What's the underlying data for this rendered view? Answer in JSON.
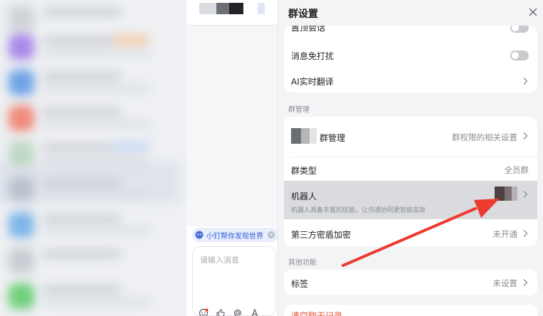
{
  "chat": {
    "hint_pill_text": "小钉帮你发现世界",
    "composer_placeholder": "请输入消息"
  },
  "panel": {
    "title": "群设置",
    "top_card": {
      "pinned_label": "置顶会话",
      "mute_label": "消息免打扰",
      "translate_label": "AI实时翻译"
    },
    "section_group_label": "群管理",
    "group_card": {
      "manage_label": "群管理",
      "manage_value": "群权限的相关设置",
      "type_label": "群类型",
      "type_value": "全员群",
      "robot_label": "机器人",
      "robot_desc": "机器人具备丰富的技能，让沟通协同更智能高效",
      "encrypt_label": "第三方密盾加密",
      "encrypt_value": "未开通"
    },
    "section_other_label": "其他功能",
    "other_card": {
      "tag_label": "标签",
      "tag_value": "未设置"
    },
    "partial_bottom_label": "清空聊天记录"
  },
  "colors": {
    "accent_red": "#ee3a2f",
    "link_blue": "#2f5bd6",
    "danger_text": "#e8503a"
  },
  "icons": [
    "close-icon",
    "chevron-right-icon",
    "hint-bot-icon",
    "emoji-icon",
    "thumbs-up-icon",
    "at-icon",
    "font-icon"
  ]
}
